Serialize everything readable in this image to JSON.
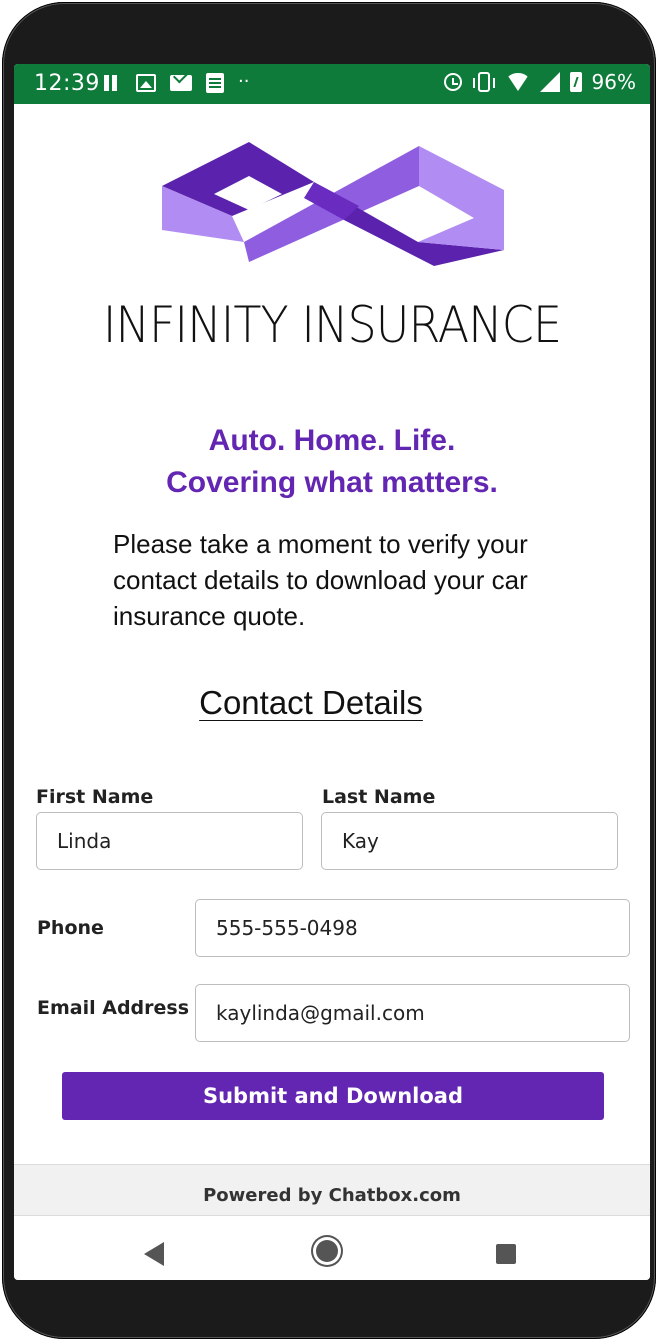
{
  "status_bar": {
    "time": "12:39",
    "battery": "96%",
    "left_icons": [
      "pause-icon",
      "image-icon",
      "mail-icon",
      "document-icon",
      "more-dots-icon"
    ],
    "right_icons": [
      "alarm-icon",
      "vibrate-icon",
      "wifi-icon",
      "signal-icon",
      "battery-icon"
    ],
    "color": "#0e7b3a"
  },
  "brand": {
    "name": "INFINITY INSURANCE",
    "logo_colors": [
      "#5b23ad",
      "#8f5ee0",
      "#b18cf2"
    ]
  },
  "tagline": {
    "line1": "Auto. Home. Life.",
    "line2": "Covering what matters."
  },
  "intro_text": "Please take a moment to verify your contact details to download your car insurance quote.",
  "form": {
    "title": "Contact Details",
    "first_name": {
      "label": "First Name",
      "value": "Linda"
    },
    "last_name": {
      "label": "Last Name",
      "value": "Kay"
    },
    "phone": {
      "label": "Phone",
      "value": "555-555-0498"
    },
    "email": {
      "label": "Email Address",
      "value": "kaylinda@gmail.com"
    },
    "submit_label": "Submit and Download"
  },
  "footer": {
    "text": "Powered by Chatbox.com"
  },
  "nav": {
    "icons": [
      "back-icon",
      "home-icon",
      "recent-apps-icon"
    ]
  },
  "colors": {
    "accent": "#6326b2"
  }
}
